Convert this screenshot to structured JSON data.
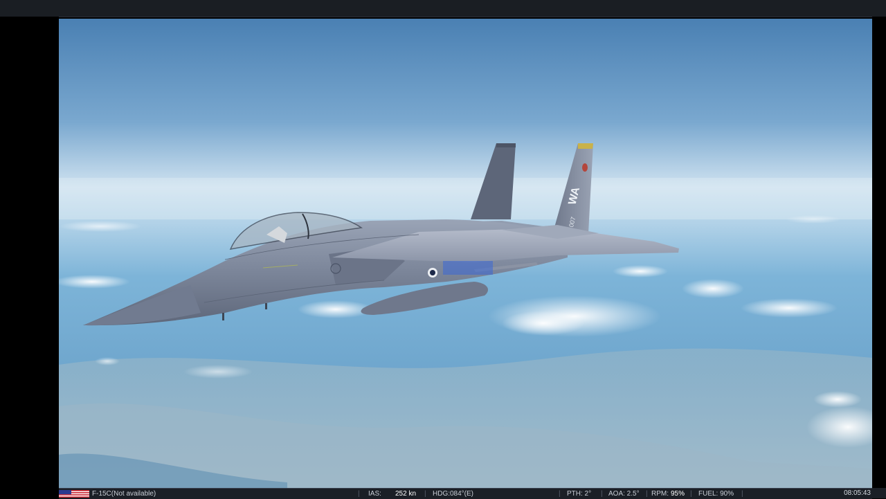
{
  "hud": {
    "aircraft": "F-15C(Not available)",
    "ias_label": "IAS:",
    "ias_value": "252 kn",
    "hdg": "HDG:084°(E)",
    "pth": "PTH: 2°",
    "aoa": "AOA: 2.5°",
    "rpm_label": "RPM:",
    "rpm_value": "95%",
    "fuel": "FUEL: 90%",
    "time": "08:05:43"
  },
  "aircraft": {
    "tail_code": "WA",
    "tail_number": "007"
  },
  "colors": {
    "sky_top": "#4f86b8",
    "sky_horizon": "#d9e9f4",
    "sea": "#6fa8cf",
    "aircraft_gray": "#7f8a9f",
    "hud_bg": "#1b1f26"
  },
  "icons": {
    "country_flag": "usa-flag-icon"
  }
}
